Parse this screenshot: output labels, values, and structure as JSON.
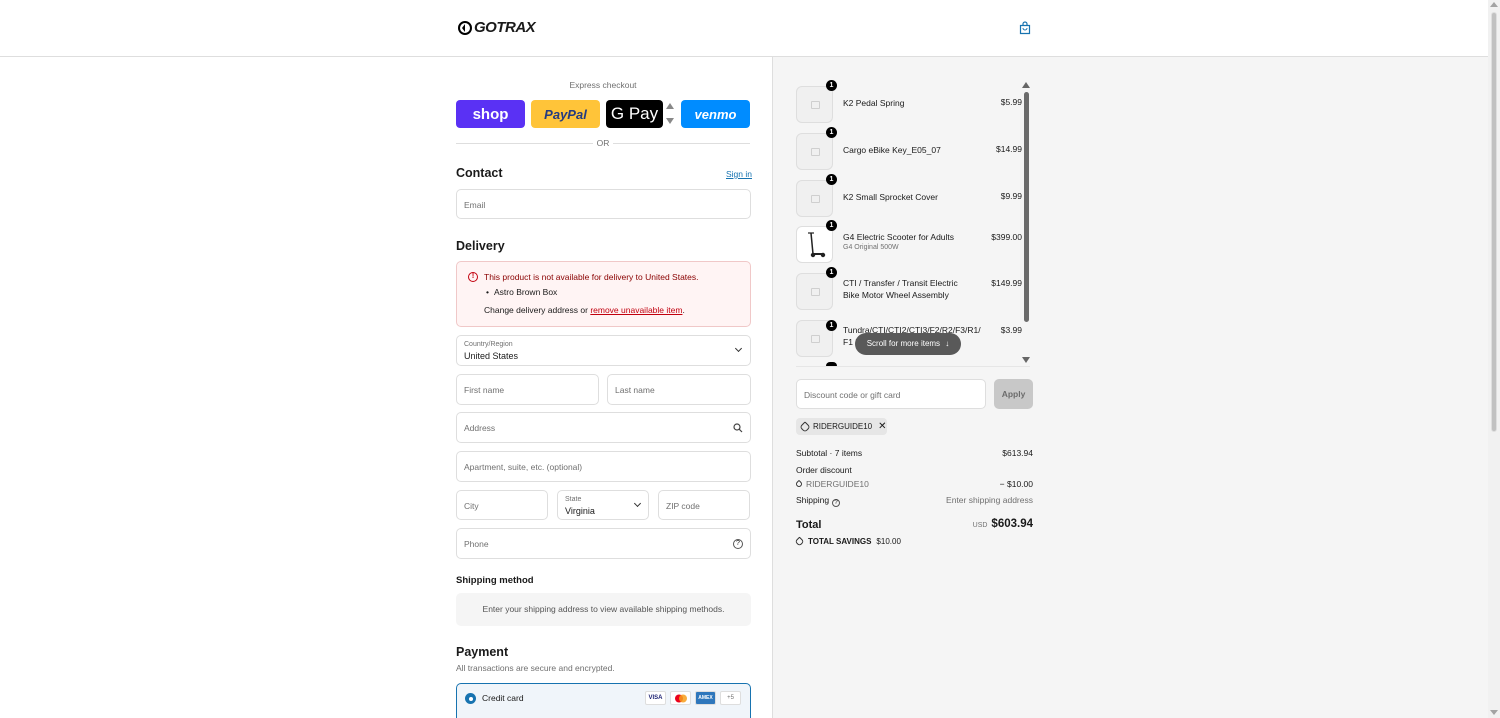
{
  "header": {
    "brand": "GOTRAX"
  },
  "express": {
    "label": "Express checkout",
    "shop": "shop",
    "paypal": "PayPal",
    "gpay": "G Pay",
    "venmo": "venmo",
    "or": "OR"
  },
  "contact": {
    "title": "Contact",
    "sign_in": "Sign in",
    "email_placeholder": "Email"
  },
  "delivery": {
    "title": "Delivery",
    "alert_title": "This product is not available for delivery to United States.",
    "alert_item": "Astro Brown Box",
    "alert_foot_prefix": "Change delivery address or ",
    "alert_foot_link": "remove unavailable item",
    "alert_foot_suffix": ".",
    "country_label": "Country/Region",
    "country_value": "United States",
    "first_name": "First name",
    "last_name": "Last name",
    "address": "Address",
    "apartment": "Apartment, suite, etc. (optional)",
    "city": "City",
    "state_label": "State",
    "state_value": "Virginia",
    "zip": "ZIP code",
    "phone": "Phone"
  },
  "shipping_method": {
    "title": "Shipping method",
    "message": "Enter your shipping address to view available shipping methods."
  },
  "payment": {
    "title": "Payment",
    "subtitle": "All transactions are secure and encrypted.",
    "credit_card": "Credit card",
    "cards": [
      "VISA",
      "MC",
      "AMEX",
      "+5"
    ]
  },
  "order": {
    "items": [
      {
        "qty": "1",
        "name": "K2 Pedal Spring",
        "variant": "",
        "price": "$5.99"
      },
      {
        "qty": "1",
        "name": "Cargo eBike Key_E05_07",
        "variant": "",
        "price": "$14.99"
      },
      {
        "qty": "1",
        "name": "K2 Small Sprocket Cover",
        "variant": "",
        "price": "$9.99"
      },
      {
        "qty": "1",
        "name": "G4 Electric Scooter for Adults",
        "variant": "G4 Original 500W",
        "price": "$399.00"
      },
      {
        "qty": "1",
        "name": "CTI / Transfer / Transit Electric Bike Motor Wheel Assembly",
        "variant": "",
        "price": "$149.99"
      },
      {
        "qty": "1",
        "name": "Tundra/CTI/CTI2/CTI3/F2/R2/F3/R1/F1 Fro",
        "variant": "",
        "price": "$3.99"
      }
    ],
    "scroll_hint": "Scroll for more items",
    "discount_placeholder": "Discount code or gift card",
    "apply": "Apply",
    "applied_code": "RIDERGUIDE10",
    "subtotal_label": "Subtotal · 7 items",
    "subtotal_value": "$613.94",
    "order_discount_label": "Order discount",
    "discount_code": "RIDERGUIDE10",
    "discount_value": "− $10.00",
    "shipping_label": "Shipping",
    "shipping_value": "Enter shipping address",
    "total_label": "Total",
    "currency": "USD",
    "total_value": "$603.94",
    "savings_label": "TOTAL SAVINGS",
    "savings_value": "$10.00"
  }
}
